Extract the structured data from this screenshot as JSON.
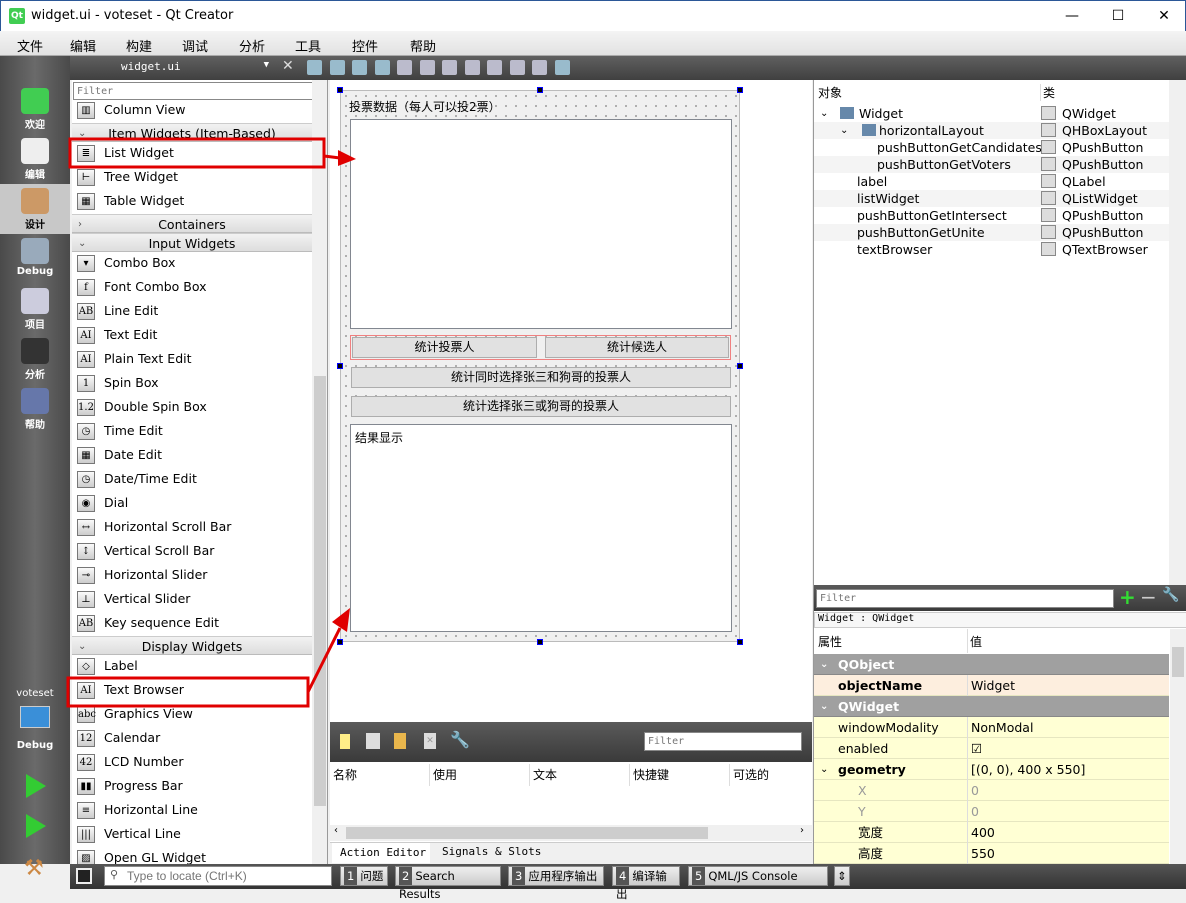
{
  "window": {
    "title": "widget.ui - voteset - Qt Creator",
    "logo": "Qt",
    "minimize": "—",
    "maximize": "☐",
    "close": "✕"
  },
  "menu": [
    "文件",
    "编辑",
    "构建",
    "调试",
    "分析",
    "工具",
    "控件",
    "帮助"
  ],
  "modes": [
    {
      "label": "欢迎",
      "icon": "qt-welcome-icon"
    },
    {
      "label": "编辑",
      "icon": "edit-icon"
    },
    {
      "label": "设计",
      "icon": "design-icon",
      "active": true
    },
    {
      "label": "Debug",
      "icon": "debug-bug-icon"
    },
    {
      "label": "项目",
      "icon": "project-icon"
    },
    {
      "label": "分析",
      "icon": "analyze-icon"
    },
    {
      "label": "帮助",
      "icon": "help-icon"
    }
  ],
  "kit": {
    "project": "voteset",
    "mode": "Debug"
  },
  "toolbar": {
    "file": "widget.ui"
  },
  "widgetbox": {
    "filter_placeholder": "Filter",
    "rows": [
      {
        "type": "item",
        "label": "Column View",
        "glyph": "▥"
      },
      {
        "type": "head",
        "label": "Item Widgets (Item-Based)",
        "open": true
      },
      {
        "type": "item",
        "label": "List Widget",
        "glyph": "≣"
      },
      {
        "type": "item",
        "label": "Tree Widget",
        "glyph": "⊢"
      },
      {
        "type": "item",
        "label": "Table Widget",
        "glyph": "▦"
      },
      {
        "type": "head",
        "label": "Containers",
        "open": false
      },
      {
        "type": "head",
        "label": "Input Widgets",
        "open": true
      },
      {
        "type": "item",
        "label": "Combo Box",
        "glyph": "▾"
      },
      {
        "type": "item",
        "label": "Font Combo Box",
        "glyph": "f"
      },
      {
        "type": "item",
        "label": "Line Edit",
        "glyph": "AB"
      },
      {
        "type": "item",
        "label": "Text Edit",
        "glyph": "AI"
      },
      {
        "type": "item",
        "label": "Plain Text Edit",
        "glyph": "AI"
      },
      {
        "type": "item",
        "label": "Spin Box",
        "glyph": "1"
      },
      {
        "type": "item",
        "label": "Double Spin Box",
        "glyph": "1.2"
      },
      {
        "type": "item",
        "label": "Time Edit",
        "glyph": "◷"
      },
      {
        "type": "item",
        "label": "Date Edit",
        "glyph": "▦"
      },
      {
        "type": "item",
        "label": "Date/Time Edit",
        "glyph": "◷"
      },
      {
        "type": "item",
        "label": "Dial",
        "glyph": "◉"
      },
      {
        "type": "item",
        "label": "Horizontal Scroll Bar",
        "glyph": "↔"
      },
      {
        "type": "item",
        "label": "Vertical Scroll Bar",
        "glyph": "↕"
      },
      {
        "type": "item",
        "label": "Horizontal Slider",
        "glyph": "⊸"
      },
      {
        "type": "item",
        "label": "Vertical Slider",
        "glyph": "⊥"
      },
      {
        "type": "item",
        "label": "Key sequence Edit",
        "glyph": "AB"
      },
      {
        "type": "head",
        "label": "Display Widgets",
        "open": true
      },
      {
        "type": "item",
        "label": "Label",
        "glyph": "◇"
      },
      {
        "type": "item",
        "label": "Text Browser",
        "glyph": "AI"
      },
      {
        "type": "item",
        "label": "Graphics View",
        "glyph": "abc"
      },
      {
        "type": "item",
        "label": "Calendar",
        "glyph": "12"
      },
      {
        "type": "item",
        "label": "LCD Number",
        "glyph": "42"
      },
      {
        "type": "item",
        "label": "Progress Bar",
        "glyph": "▮▮"
      },
      {
        "type": "item",
        "label": "Horizontal Line",
        "glyph": "≡"
      },
      {
        "type": "item",
        "label": "Vertical Line",
        "glyph": "|||"
      },
      {
        "type": "item",
        "label": "Open GL Widget",
        "glyph": "▨"
      }
    ]
  },
  "form": {
    "label": "投票数据（每人可以投2票）",
    "btn_voters": "统计投票人",
    "btn_candidates": "统计候选人",
    "btn_intersect": "统计同时选择张三和狗哥的投票人",
    "btn_unite": "统计选择张三或狗哥的投票人",
    "result": "结果显示"
  },
  "action_editor": {
    "filter_placeholder": "Filter",
    "columns": [
      "名称",
      "使用",
      "文本",
      "快捷键",
      "可选的"
    ],
    "tabs": [
      "Action Editor",
      "Signals & Slots Editor"
    ]
  },
  "object_inspector": {
    "headers": [
      "对象",
      "类"
    ],
    "rows": [
      {
        "name": "Widget",
        "cls": "QWidget",
        "indent": 0,
        "expand": true
      },
      {
        "name": "horizontalLayout",
        "cls": "QHBoxLayout",
        "indent": 1,
        "expand": true
      },
      {
        "name": "pushButtonGetCandidates",
        "cls": "QPushButton",
        "indent": 2
      },
      {
        "name": "pushButtonGetVoters",
        "cls": "QPushButton",
        "indent": 2
      },
      {
        "name": "label",
        "cls": "QLabel",
        "indent": 1
      },
      {
        "name": "listWidget",
        "cls": "QListWidget",
        "indent": 1
      },
      {
        "name": "pushButtonGetIntersect",
        "cls": "QPushButton",
        "indent": 1
      },
      {
        "name": "pushButtonGetUnite",
        "cls": "QPushButton",
        "indent": 1
      },
      {
        "name": "textBrowser",
        "cls": "QTextBrowser",
        "indent": 1
      }
    ]
  },
  "property_editor": {
    "filter_placeholder": "Filter",
    "context": "Widget : QWidget",
    "headers": [
      "属性",
      "值"
    ],
    "rows": [
      {
        "kind": "grp",
        "name": "QObject"
      },
      {
        "kind": "obj",
        "name": "objectName",
        "value": "Widget",
        "bold": true
      },
      {
        "kind": "grp",
        "name": "QWidget"
      },
      {
        "kind": "p",
        "name": "windowModality",
        "value": "NonModal"
      },
      {
        "kind": "p",
        "name": "enabled",
        "value": "☑"
      },
      {
        "kind": "p",
        "name": "geometry",
        "value": "[(0, 0), 400 x 550]",
        "bold": true,
        "expand": true
      },
      {
        "kind": "sub",
        "name": "X",
        "value": "0",
        "dim": true
      },
      {
        "kind": "sub",
        "name": "Y",
        "value": "0",
        "dim": true
      },
      {
        "kind": "sub",
        "name": "宽度",
        "value": "400"
      },
      {
        "kind": "sub",
        "name": "高度",
        "value": "550"
      }
    ]
  },
  "statusbar": {
    "locate_placeholder": "Type to locate (Ctrl+K)",
    "panes": [
      {
        "n": "1",
        "label": "问题"
      },
      {
        "n": "2",
        "label": "Search Results"
      },
      {
        "n": "3",
        "label": "应用程序输出"
      },
      {
        "n": "4",
        "label": "编译输出"
      },
      {
        "n": "5",
        "label": "QML/JS Console"
      }
    ]
  },
  "colors": {
    "annotation": "#e00000",
    "accent": "#41cd52"
  }
}
